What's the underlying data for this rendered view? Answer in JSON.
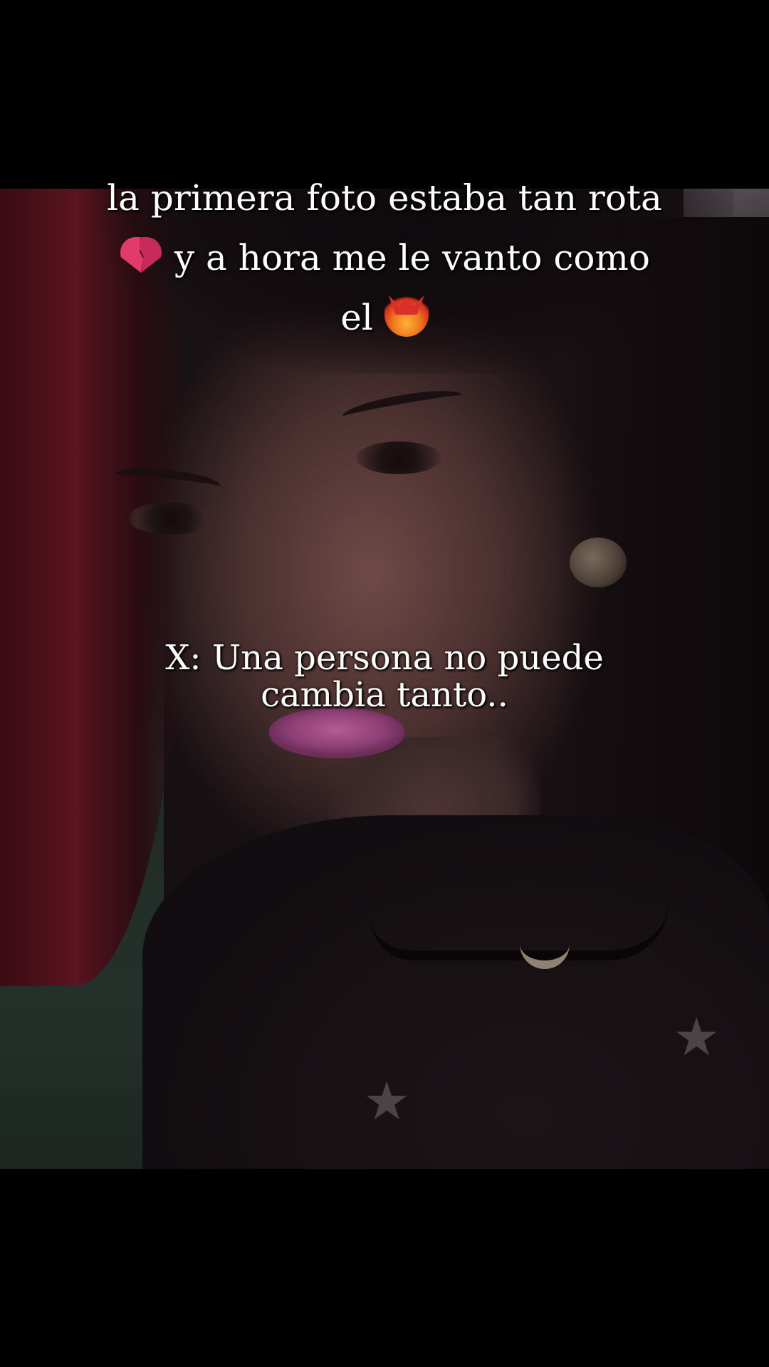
{
  "caption_top": {
    "line1": "la primera foto estaba tan rota",
    "line2_text": " y a hora me le vanto como",
    "line3_text": "el ",
    "icons": [
      "broken-heart-icon",
      "phoenix-icon"
    ]
  },
  "caption_mid": {
    "line1": "X: Una persona no puede",
    "line2": "cambia tanto.."
  },
  "colors": {
    "background": "#000000",
    "text": "#ffffff",
    "lips": "#b45c96",
    "hair_streak": "#5a1420"
  }
}
